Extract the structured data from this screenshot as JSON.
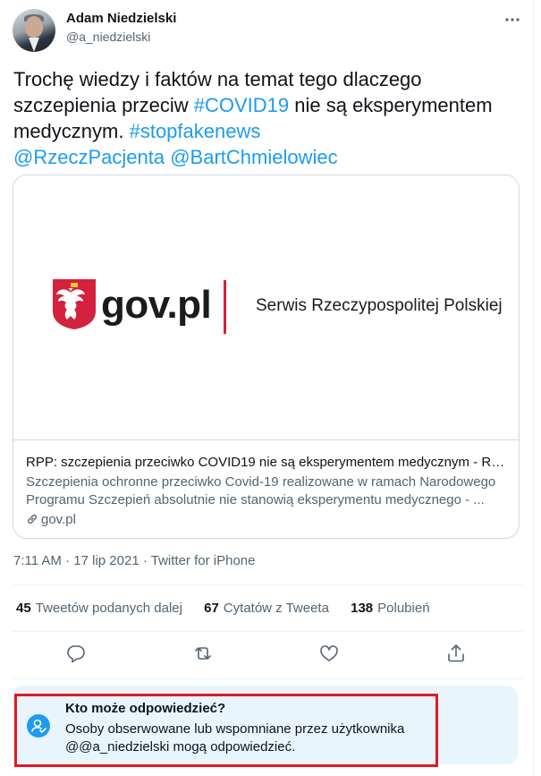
{
  "author": {
    "name": "Adam Niedzielski",
    "handle": "@a_niedzielski"
  },
  "tweet": {
    "text_parts": [
      {
        "text": "Trochę wiedzy i faktów na temat tego dlaczego szczepienia przeciw ",
        "link": false
      },
      {
        "text": "#COVID19",
        "link": true
      },
      {
        "text": " nie są eksperymentem medycznym. ",
        "link": false
      },
      {
        "text": "#stopfakenews",
        "link": true
      },
      {
        "text": "@RzeczPacjenta",
        "link": true
      },
      {
        "text": " ",
        "link": false
      },
      {
        "text": "@BartChmielowiec",
        "link": true
      }
    ]
  },
  "card": {
    "logo_text": "gov.pl",
    "service_text": "Serwis Rzeczypospolitej Polskiej",
    "title": "RPP: szczepienia przeciwko COVID19 nie są eksperymentem medycznym - Rzeczni...",
    "description": "Szczepienia ochronne przeciwko Covid-19 realizowane w ramach Narodowego Programu Szczepień absolutnie nie stanowią eksperymentu medycznego - ...",
    "domain": "gov.pl"
  },
  "meta": {
    "time": "7:11 AM",
    "date": "17 lip 2021",
    "source": "Twitter for iPhone"
  },
  "stats": {
    "retweets_count": "45",
    "retweets_label": "Tweetów podanych dalej",
    "quotes_count": "67",
    "quotes_label": "Cytatów z Tweeta",
    "likes_count": "138",
    "likes_label": "Polubień"
  },
  "notice": {
    "title": "Kto może odpowiedzieć?",
    "body": "Osoby obserwowane lub wspomniane przez użytkownika @@a_niedzielski mogą odpowiedzieć."
  },
  "colors": {
    "link": "#1d9bf0",
    "secondary_text": "#536471",
    "notice_bg": "#e8f5fd",
    "highlight_outline": "#e3191f",
    "gov_red": "#d4213d"
  },
  "icons": [
    "more-icon",
    "reply-icon",
    "retweet-icon",
    "like-icon",
    "share-icon",
    "link-icon",
    "user-check-icon",
    "eagle-emblem"
  ]
}
